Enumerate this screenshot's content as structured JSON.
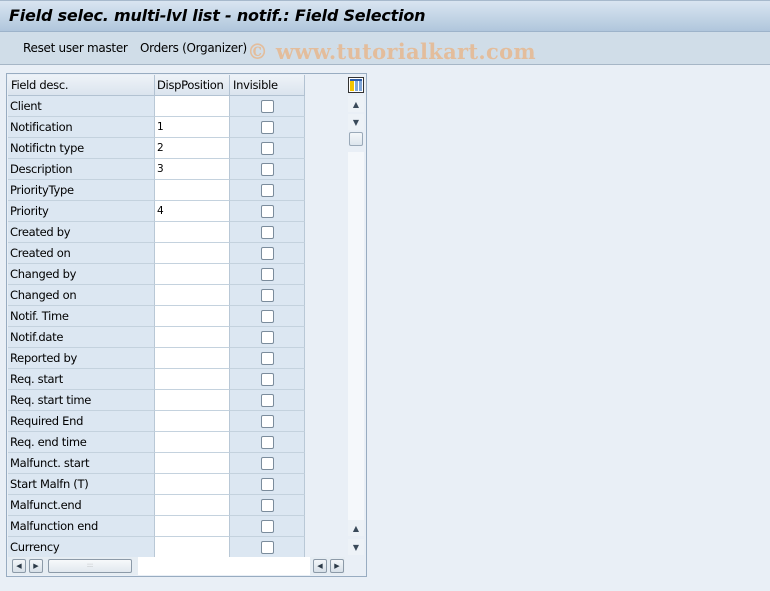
{
  "window": {
    "title": "Field selec. multi-lvl list - notif.: Field Selection"
  },
  "toolbar": {
    "buttons": [
      {
        "label": "Reset user master"
      },
      {
        "label": "Orders (Organizer)"
      }
    ]
  },
  "watermark": "© www.tutorialkart.com",
  "table": {
    "columns": [
      "Field desc.",
      "DispPosition",
      "Invisible"
    ],
    "rows": [
      {
        "field": "Client",
        "disp_position": "",
        "invisible": false
      },
      {
        "field": "Notification",
        "disp_position": "1",
        "invisible": false
      },
      {
        "field": "Notifictn type",
        "disp_position": "2",
        "invisible": false
      },
      {
        "field": "Description",
        "disp_position": "3",
        "invisible": false
      },
      {
        "field": "PriorityType",
        "disp_position": "",
        "invisible": false
      },
      {
        "field": "Priority",
        "disp_position": "4",
        "invisible": false
      },
      {
        "field": "Created by",
        "disp_position": "",
        "invisible": false
      },
      {
        "field": "Created on",
        "disp_position": "",
        "invisible": false
      },
      {
        "field": "Changed by",
        "disp_position": "",
        "invisible": false
      },
      {
        "field": "Changed on",
        "disp_position": "",
        "invisible": false
      },
      {
        "field": "Notif. Time",
        "disp_position": "",
        "invisible": false
      },
      {
        "field": "Notif.date",
        "disp_position": "",
        "invisible": false
      },
      {
        "field": "Reported by",
        "disp_position": "",
        "invisible": false
      },
      {
        "field": "Req. start",
        "disp_position": "",
        "invisible": false
      },
      {
        "field": "Req. start time",
        "disp_position": "",
        "invisible": false
      },
      {
        "field": "Required End",
        "disp_position": "",
        "invisible": false
      },
      {
        "field": "Req. end time",
        "disp_position": "",
        "invisible": false
      },
      {
        "field": "Malfunct. start",
        "disp_position": "",
        "invisible": false
      },
      {
        "field": "Start Malfn (T)",
        "disp_position": "",
        "invisible": false
      },
      {
        "field": "Malfunct.end",
        "disp_position": "",
        "invisible": false
      },
      {
        "field": "Malfunction end",
        "disp_position": "",
        "invisible": false
      },
      {
        "field": "Currency",
        "disp_position": "",
        "invisible": false
      }
    ]
  },
  "icons": {
    "column_config": "column-layout-icon",
    "scroll_up": "▲",
    "scroll_down": "▼",
    "scroll_left": "◀",
    "scroll_right": "▶",
    "thumb_grip": ":::"
  }
}
